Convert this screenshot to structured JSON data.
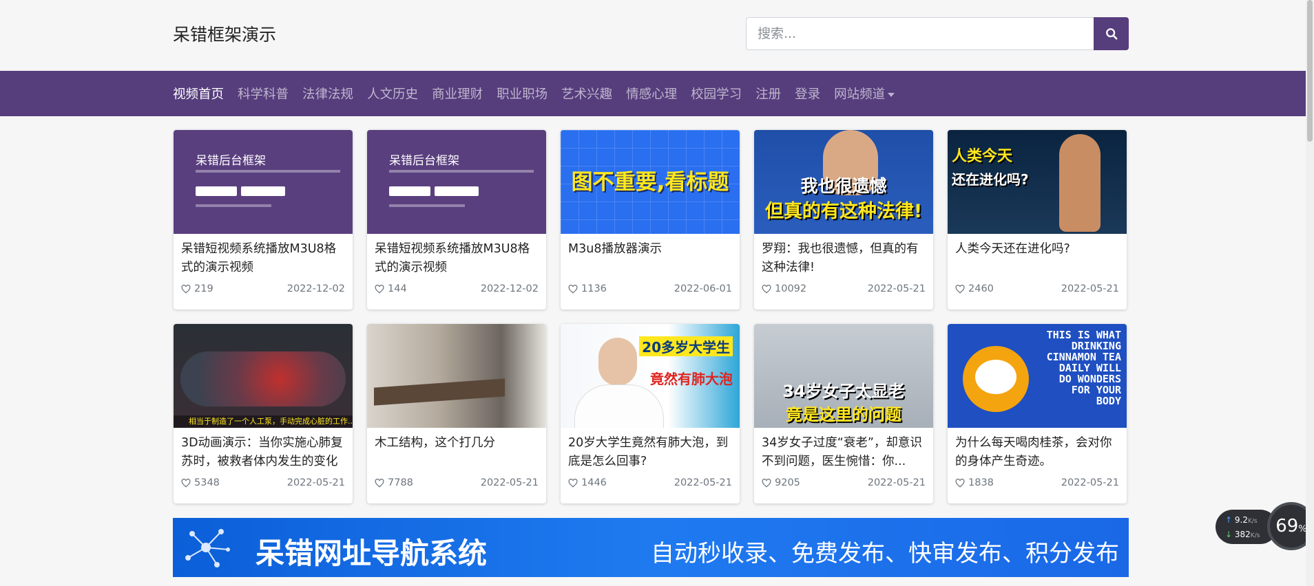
{
  "header": {
    "brand": "呆错框架演示",
    "search_placeholder": "搜索..."
  },
  "nav": {
    "items": [
      "视频首页",
      "科学科普",
      "法律法规",
      "人文历史",
      "商业理财",
      "职业职场",
      "艺术兴趣",
      "情感心理",
      "校园学习",
      "注册",
      "登录"
    ],
    "dropdown": "网站频道"
  },
  "thumb_text": {
    "admin_title": "呆错后台框架",
    "blue_caption": "图不重要,看标题",
    "law_line1": "我也很遗憾",
    "law_line2": "但真的有这种法律!",
    "evo_line1": "人类今天",
    "evo_line2": "还在进化吗?",
    "anat_caption": "相当于制造了一个人工泵，手动完成心脏的工作...",
    "doc_line1": "20多岁大学生",
    "doc_line2": "竟然有肺大泡",
    "clinic_line1": "34岁女子太显老",
    "clinic_line2": "竟是这里的问题",
    "tea_en": "THIS IS WHAT DRINKING CINNAMON TEA DAILY WILL DO WONDERS FOR YOUR BODY"
  },
  "videos": [
    {
      "title": "呆错短视频系统播放M3U8格式的演示视频",
      "likes": "219",
      "date": "2022-12-02",
      "thumb": "admin"
    },
    {
      "title": "呆错短视频系统播放M3U8格式的演示视频",
      "likes": "144",
      "date": "2022-12-02",
      "thumb": "admin"
    },
    {
      "title": "M3u8播放器演示",
      "likes": "1136",
      "date": "2022-06-01",
      "thumb": "blue"
    },
    {
      "title": "罗翔：我也很遗憾，但真的有这种法律!",
      "likes": "10092",
      "date": "2022-05-21",
      "thumb": "law"
    },
    {
      "title": "人类今天还在进化吗?",
      "likes": "2460",
      "date": "2022-05-21",
      "thumb": "evo"
    },
    {
      "title": "3D动画演示：当你实施心肺复苏时，被救者体内发生的变化",
      "likes": "5348",
      "date": "2022-05-21",
      "thumb": "anat"
    },
    {
      "title": "木工结构，这个打几分",
      "likes": "7788",
      "date": "2022-05-21",
      "thumb": "wood"
    },
    {
      "title": "20岁大学生竟然有肺大泡，到底是怎么回事?",
      "likes": "1446",
      "date": "2022-05-21",
      "thumb": "doc"
    },
    {
      "title": "34岁女子过度“衰老”，却意识不到问题，医生惋惜：你...",
      "likes": "9205",
      "date": "2022-05-21",
      "thumb": "clinic"
    },
    {
      "title": "为什么每天喝肉桂茶，会对你的身体产生奇迹。",
      "likes": "1838",
      "date": "2022-05-21",
      "thumb": "tea"
    }
  ],
  "banner": {
    "title": "呆错网址导航系统",
    "subtitle": "自动秒收录、免费发布、快审发布、积分发布"
  },
  "net_widget": {
    "upload": "9.2",
    "download": "382",
    "unit": "K/s",
    "cpu": "69",
    "cpu_unit": "%"
  },
  "colors": {
    "brand_purple": "#563d7c",
    "page_bg": "#f6f6f7"
  }
}
